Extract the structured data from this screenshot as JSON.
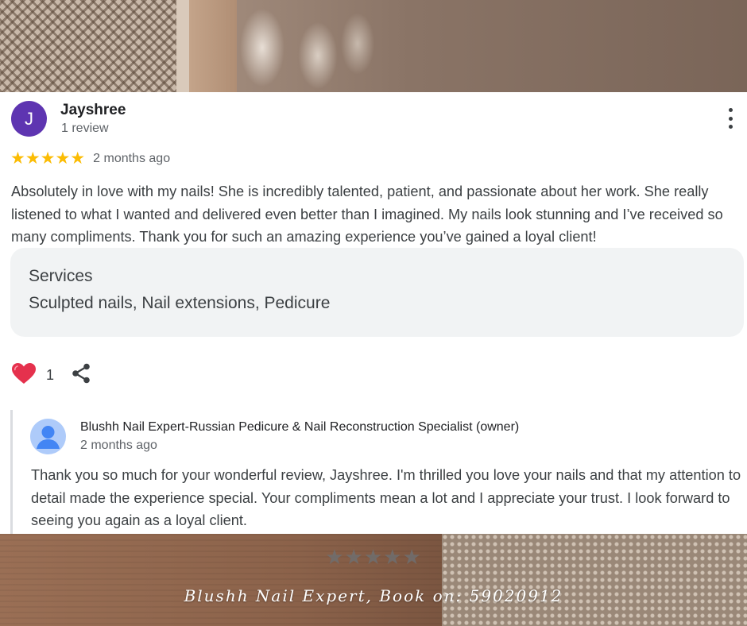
{
  "review": {
    "avatar_letter": "J",
    "reviewer_name": "Jayshree",
    "review_count": "1 review",
    "rating": 5,
    "stars": "★★★★★",
    "time": "2 months ago",
    "text": "Absolutely in love with my nails! She is incredibly talented, patient, and passionate about her work. She really listened to what I wanted and delivered even better than I imagined. My nails look stunning and I’ve received so many compliments. Thank you for such an amazing experience you’ve gained a loyal client!",
    "services_title": "Services",
    "services_list": "Sculpted nails, Nail extensions, Pedicure",
    "like_count": "1"
  },
  "owner_reply": {
    "name": "Blushh Nail Expert-Russian Pedicure & Nail Reconstruction Specialist (owner)",
    "time": "2 months ago",
    "text": "Thank you so much for your wonderful review, Jayshree. I'm thrilled you love your nails and that my attention to detail made the experience special. Your compliments mean a lot and I appreciate your trust. I look forward to seeing you again as a loyal client."
  },
  "footer": {
    "stars": "★★★★★",
    "text": "Blushh Nail Expert, Book on: 59020912"
  },
  "colors": {
    "avatar_bg": "#5e35b1",
    "star": "#fbbc04",
    "heart": "#e5314d",
    "owner_avatar_bg": "#aecbfa",
    "owner_avatar_fg": "#4285f4"
  }
}
